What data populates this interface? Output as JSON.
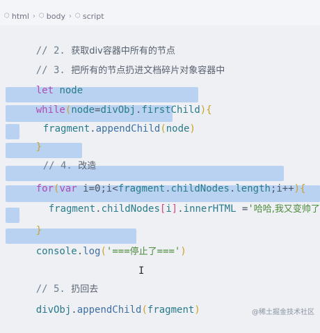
{
  "breadcrumb": {
    "items": [
      "html",
      "body",
      "script"
    ]
  },
  "editor": {
    "line1": {
      "comment": "// 2. ",
      "text": "获取div容器中所有的节点"
    },
    "line2": {
      "comment": "// 3. ",
      "text": "把所有的节点扔进文档碎片对象容器中"
    },
    "line3": {
      "kw": "let",
      "var": "node"
    },
    "line4": {
      "kw": "while",
      "p1": "(",
      "a": "node",
      "eq": "=",
      "b": "divObj",
      "dot": ".",
      "c": "firstChild",
      "p2": "){"
    },
    "line5": {
      "a": "fragment",
      "dot": ".",
      "fn": "appendChild",
      "p1": "(",
      "arg": "node",
      "p2": ")"
    },
    "line6": {
      "b": "}"
    },
    "line7": {
      "comment": "// 4. ",
      "text": "改造"
    },
    "line8": {
      "kw": "for",
      "p1": "(",
      "kw2": "var",
      "rest": " i=0;i<",
      "a": "fragment",
      "dot": ".",
      "b": "childNodes",
      "dot2": ".",
      "c": "length",
      "rest2": ";i++",
      "p2": "){"
    },
    "line9": {
      "a": "fragment",
      "dot": ".",
      "b": "childNodes",
      "br1": "[",
      "i": "i",
      "br2": "]",
      "dot2": ".",
      "c": "innerHTML",
      "eq": " =",
      "str1": "'",
      "strtext": "哈哈,我又变帅了",
      "str2": "'"
    },
    "line10": {
      "b": "}"
    },
    "line11": {
      "a": "console",
      "dot": ".",
      "fn": "log",
      "p1": "(",
      "s1": "'===",
      "stext": "停止了",
      "s2": "==='",
      "p2": ")"
    },
    "line12": {
      "comment": "// 5. ",
      "text": "扔回去"
    },
    "line13": {
      "a": "divObj",
      "dot": ".",
      "fn": "appendChild",
      "p1": "(",
      "arg": "fragment",
      "p2": ")"
    }
  },
  "watermark": "@稀土掘金技术社区",
  "colors": {
    "selection": "#bad2f2",
    "keyword": "#b04ab5",
    "string": "#4b8a3a"
  }
}
